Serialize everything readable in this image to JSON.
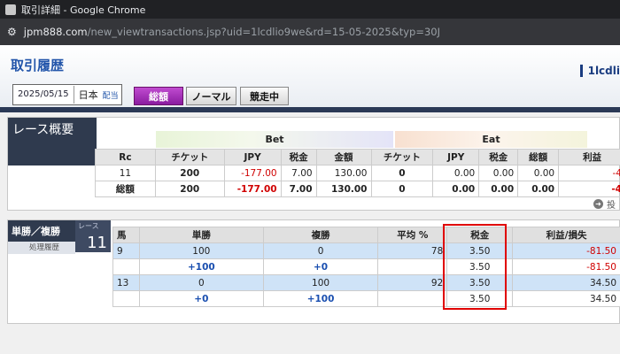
{
  "window": {
    "title": "取引詳細 - Google Chrome"
  },
  "url": {
    "host": "jpm888.com",
    "path": "/new_viewtransactions.jsp?uid=1lcdlio9we&rd=15-05-2025&typ=30J"
  },
  "header": {
    "page_title": "取引履歴",
    "user_id": "1lcdli",
    "date": "2025/05/15",
    "country": "日本",
    "delivery": "配当",
    "buttons": [
      "総額",
      "ノーマル",
      "競走中"
    ]
  },
  "overview": {
    "title": "レース概要",
    "group_bet": "Bet",
    "group_eat": "Eat",
    "columns": [
      "Rc",
      "チケット",
      "JPY",
      "税金",
      "金額",
      "チケット",
      "JPY",
      "税金",
      "総額",
      "利益"
    ],
    "rows": [
      [
        "11",
        "200",
        "-177.00",
        "7.00",
        "130.00",
        "0",
        "0.00",
        "0.00",
        "0.00",
        "-4"
      ],
      [
        "総額",
        "200",
        "-177.00",
        "7.00",
        "130.00",
        "0",
        "0.00",
        "0.00",
        "0.00",
        "-4"
      ]
    ],
    "invest_link": "投"
  },
  "winplace": {
    "title": "単勝／複勝",
    "race_label": "レース",
    "race_number": "11",
    "sub_label": "処理履歴",
    "columns": [
      "馬",
      "単勝",
      "複勝",
      "平均 %",
      "税金",
      "利益/損失"
    ],
    "rows": [
      {
        "horse": "9",
        "win": "100",
        "place": "0",
        "avg": "78",
        "tax": "3.50",
        "pl": "-81.50"
      },
      {
        "horse": "",
        "win": "+100",
        "place": "+0",
        "avg": "",
        "tax": "3.50",
        "pl": "-81.50"
      },
      {
        "horse": "13",
        "win": "0",
        "place": "100",
        "avg": "92",
        "tax": "3.50",
        "pl": "34.50"
      },
      {
        "horse": "",
        "win": "+0",
        "place": "+100",
        "avg": "",
        "tax": "3.50",
        "pl": "34.50"
      }
    ]
  },
  "colors": {
    "accent": "#2255aa",
    "active_button": "#a030b8",
    "negative": "#d00000",
    "highlight": "#e00000"
  }
}
